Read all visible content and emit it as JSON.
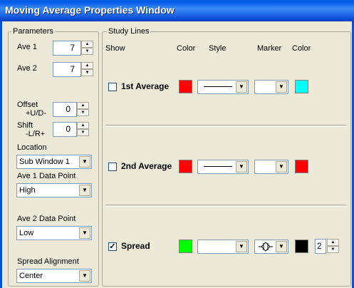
{
  "window": {
    "title": "Moving Average Properties Window"
  },
  "parameters": {
    "legend": "Parameters",
    "ave1": {
      "label": "Ave 1",
      "value": "7"
    },
    "ave2": {
      "label": "Ave 2",
      "value": "7"
    },
    "offset": {
      "label_line1": "Offset",
      "label_line2": "+U/D-",
      "value": "0"
    },
    "shift": {
      "label_line1": "Shift",
      "label_line2": "-L/R+",
      "value": "0"
    },
    "location": {
      "label": "Location",
      "value": "Sub Window  1"
    },
    "ave1_data_point": {
      "label": "Ave 1 Data Point",
      "value": "High"
    },
    "ave2_data_point": {
      "label": "Ave 2 Data Point",
      "value": "Low"
    },
    "spread_alignment": {
      "label": "Spread Alignment",
      "value": "Center"
    }
  },
  "study_lines": {
    "legend": "Study Lines",
    "headers": {
      "show": "Show",
      "color": "Color",
      "style": "Style",
      "marker": "Marker",
      "marker_color": "Color"
    },
    "rows": [
      {
        "label": "1st Average",
        "checked": false,
        "color": "#ff0000",
        "style": "line",
        "marker": "",
        "marker_color": "#00ffff"
      },
      {
        "label": "2nd Average",
        "checked": false,
        "color": "#ff0000",
        "style": "line",
        "marker": "",
        "marker_color": "#ff0000"
      },
      {
        "label": "Spread",
        "checked": true,
        "color": "#00ff00",
        "style": "",
        "marker": "diamond-bar",
        "marker_color": "#000000",
        "marker_size": "2"
      }
    ]
  },
  "check_mark": "✓"
}
